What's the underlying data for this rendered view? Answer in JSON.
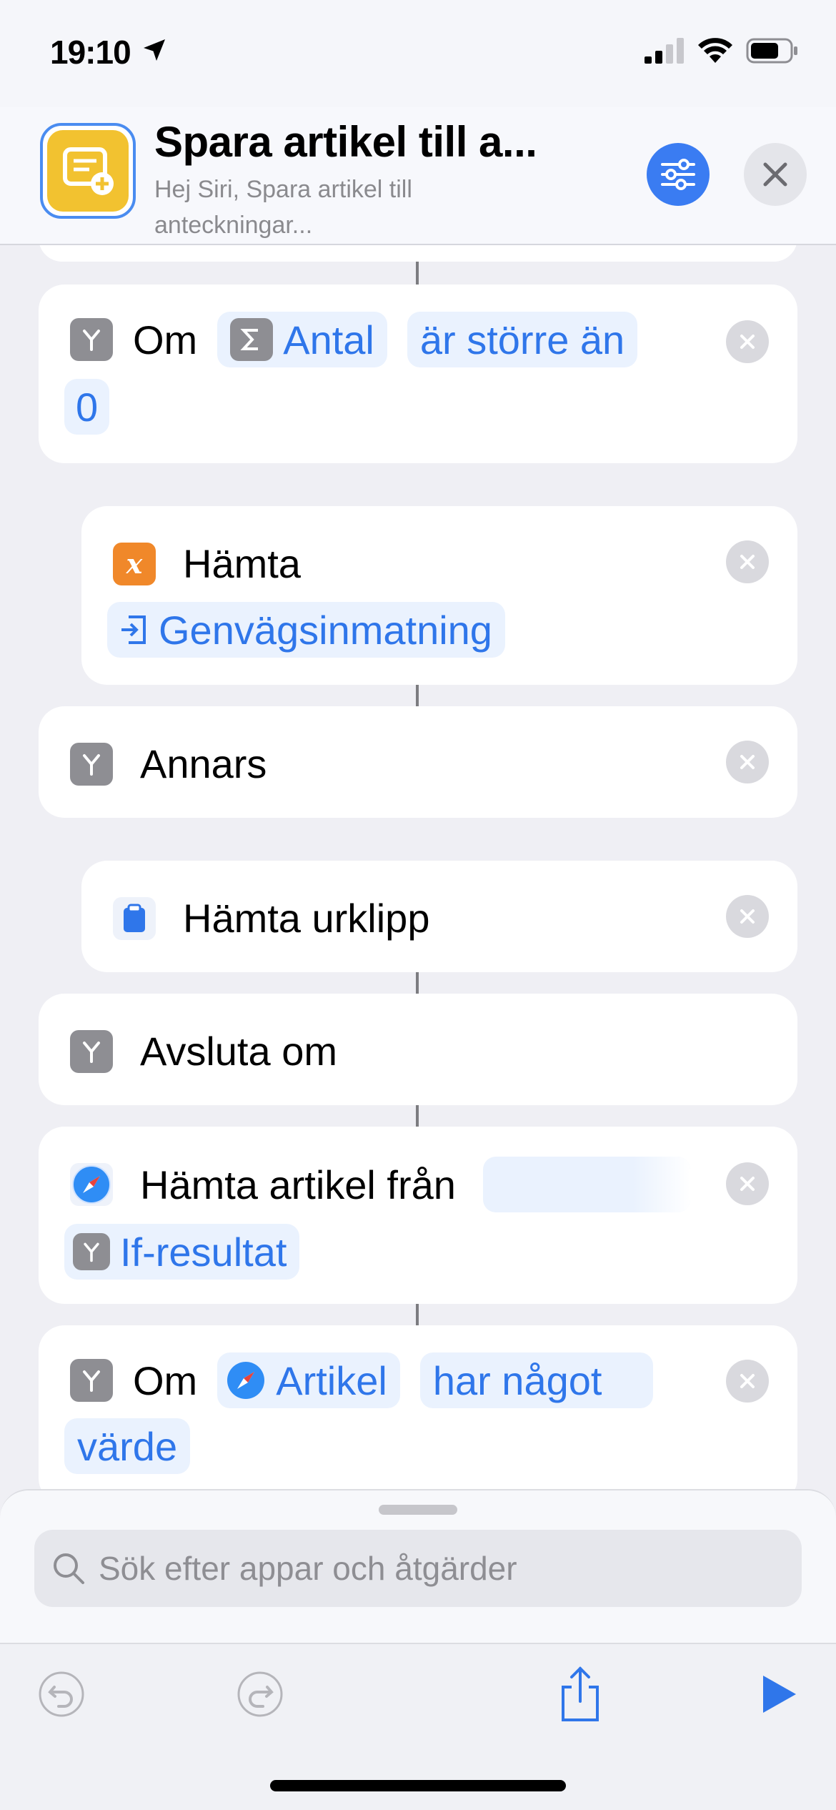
{
  "status_bar": {
    "time": "19:10"
  },
  "header": {
    "title": "Spara artikel till a...",
    "subtitle": "Hej Siri, Spara artikel till anteckningar..."
  },
  "actions": [
    {
      "keyword": "Om",
      "variable": "Antal",
      "condition": "är större än",
      "value": "0"
    },
    {
      "label": "Hämta",
      "variable": "Genvägsinmatning"
    },
    {
      "label": "Annars"
    },
    {
      "label": "Hämta urklipp"
    },
    {
      "label": "Avsluta om"
    },
    {
      "label": "Hämta artikel från",
      "variable": "If-resultat"
    },
    {
      "keyword": "Om",
      "variable": "Artikel",
      "condition": "har något",
      "condition_cont": "värde"
    }
  ],
  "search": {
    "placeholder": "Sök efter appar och åtgärder"
  },
  "colors": {
    "accent": "#2f76ea",
    "token_bg": "#eaf2fe",
    "background": "#efeff4"
  }
}
